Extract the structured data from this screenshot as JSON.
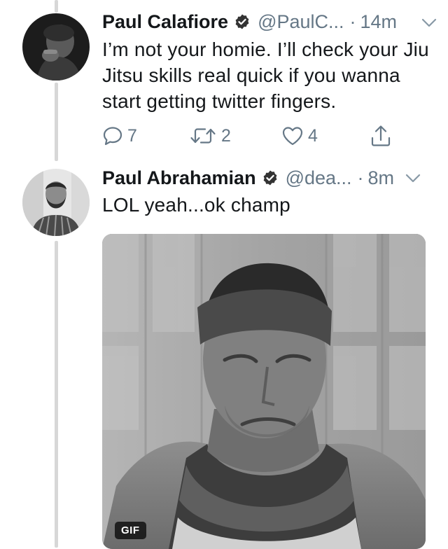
{
  "tweets": [
    {
      "name": "Paul Calafiore",
      "handle": "@PaulC...",
      "separator": "·",
      "time": "14m",
      "text": "I’m not your homie. I’ll check your Jiu Jitsu skills real quick if you wanna start getting twitter fingers.",
      "replies": "7",
      "retweets": "2",
      "likes": "4",
      "icons": [
        "verified-icon",
        "caret-down-icon",
        "reply-icon",
        "retweet-icon",
        "like-icon",
        "share-icon"
      ]
    },
    {
      "name": "Paul Abrahamian",
      "handle": "@dea...",
      "separator": "·",
      "time": "8m",
      "text": "LOL yeah...ok champ",
      "media_badge": "GIF",
      "icons": [
        "verified-icon",
        "caret-down-icon"
      ]
    }
  ],
  "colors": {
    "text": "#14171a",
    "secondary": "#657786",
    "verified_badge": "#333333",
    "thread_line": "#d7d7d7"
  }
}
